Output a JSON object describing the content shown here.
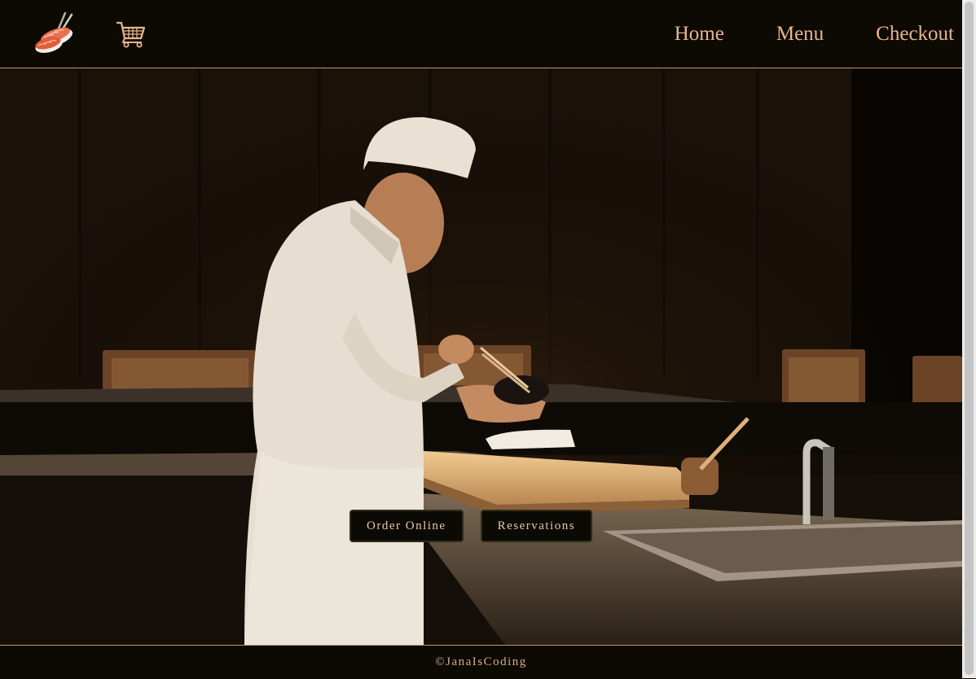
{
  "header": {
    "logo_icon": "sushi-logo-icon",
    "cart_icon": "shopping-cart-icon",
    "nav": [
      {
        "label": "Home"
      },
      {
        "label": "Menu"
      },
      {
        "label": "Checkout"
      }
    ]
  },
  "hero": {
    "image": "sushi-chef-preparing-food-photo",
    "buttons": {
      "order": "Order Online",
      "reservations": "Reservations"
    }
  },
  "footer": {
    "copyright": "©JanaIsCoding"
  },
  "colors": {
    "background": "#0d0903",
    "accent": "#e8b48f",
    "border": "#c9956c"
  }
}
